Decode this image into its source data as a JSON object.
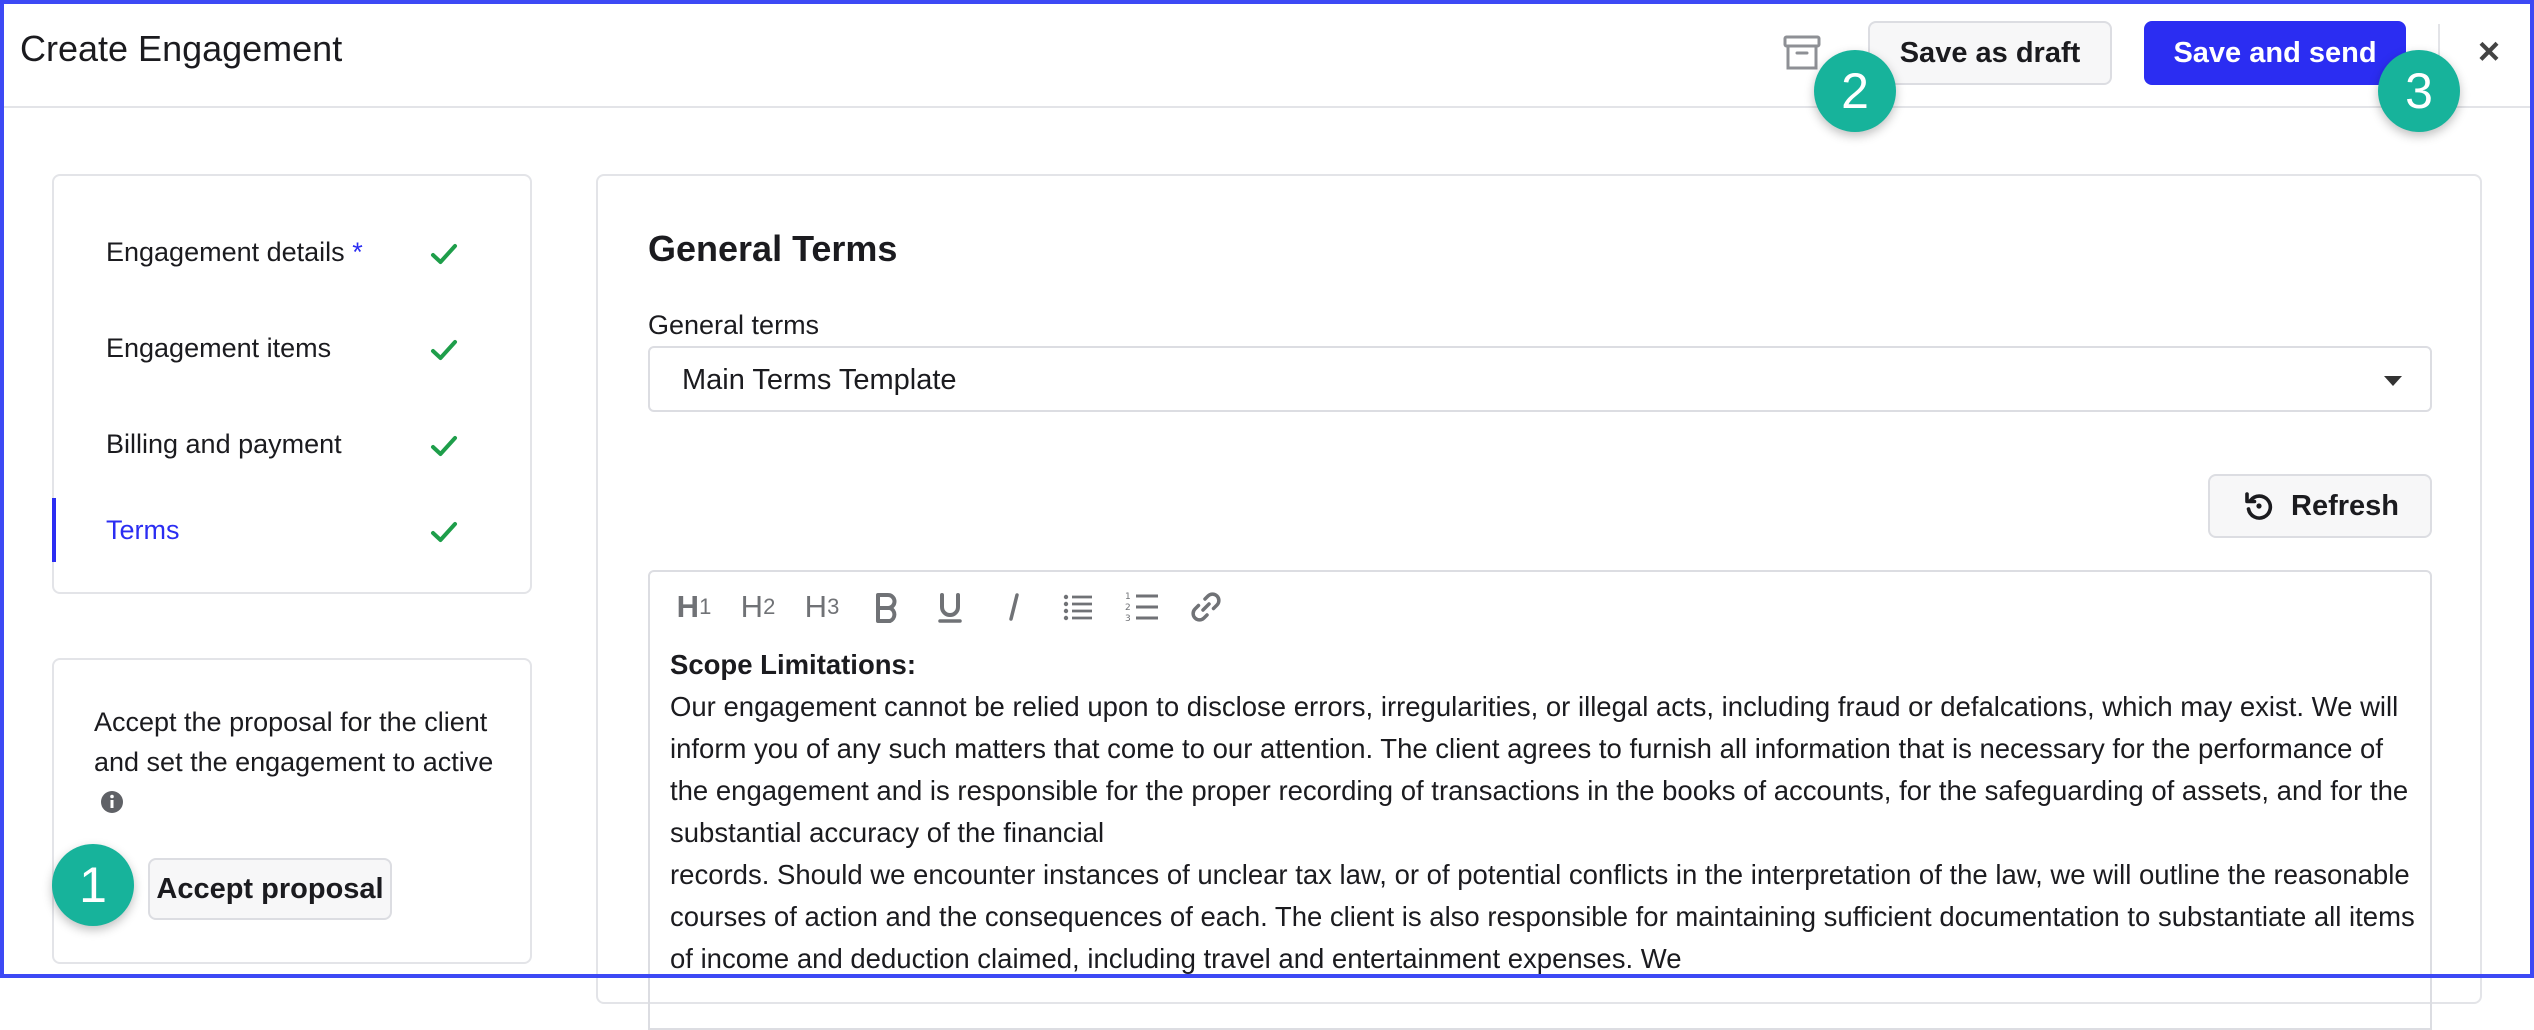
{
  "window": {
    "title": "Create Engagement"
  },
  "header": {
    "save_draft_label": "Save as draft",
    "save_send_label": "Save and send",
    "close_glyph": "×"
  },
  "badges": [
    "1",
    "2",
    "3"
  ],
  "sidebar": {
    "items": [
      {
        "label": "Engagement details",
        "required_mark": "*",
        "completed": true,
        "active": false
      },
      {
        "label": "Engagement items",
        "completed": true,
        "active": false
      },
      {
        "label": "Billing and payment",
        "completed": true,
        "active": false
      },
      {
        "label": "Terms",
        "completed": true,
        "active": true
      }
    ]
  },
  "proposal": {
    "description": "Accept the proposal for the client and set the engagement to active",
    "accept_label": "Accept proposal"
  },
  "main": {
    "section_title": "General Terms",
    "general_terms": {
      "label": "General terms",
      "selected": "Main Terms Template"
    },
    "refresh_label": "Refresh",
    "editor": {
      "toolbar": {
        "h1": "H",
        "h1_sub": "1",
        "h2": "H",
        "h2_sub": "2",
        "h3": "H",
        "h3_sub": "3"
      },
      "heading": "Scope Limitations:",
      "paragraph1": "Our engagement cannot be relied upon to disclose errors, irregularities, or illegal acts, including fraud or defalcations, which may exist. We will inform you of any such matters that come to our attention. The client agrees to furnish all information that is necessary for the performance of the engagement and is responsible for the proper recording of transactions in the books of accounts, for the safeguarding of assets, and for the substantial accuracy of the financial",
      "paragraph2": "records. Should we encounter instances of unclear tax law, or of potential conflicts in the interpretation of the law, we will outline the reasonable courses of action and the consequences of each. The client is also responsible for maintaining sufficient documentation to substantiate all items of income and deduction claimed, including travel and entertainment expenses. We"
    }
  },
  "colors": {
    "accent": "#2b2df2",
    "check": "#1e9e4a",
    "badge": "#17b39b",
    "frame": "#3d49f5"
  },
  "icons": {
    "archive": "archive-icon",
    "close": "close-icon",
    "check": "check-icon",
    "info": "info-icon",
    "refresh": "refresh-icon",
    "caret": "chevron-down-icon"
  }
}
